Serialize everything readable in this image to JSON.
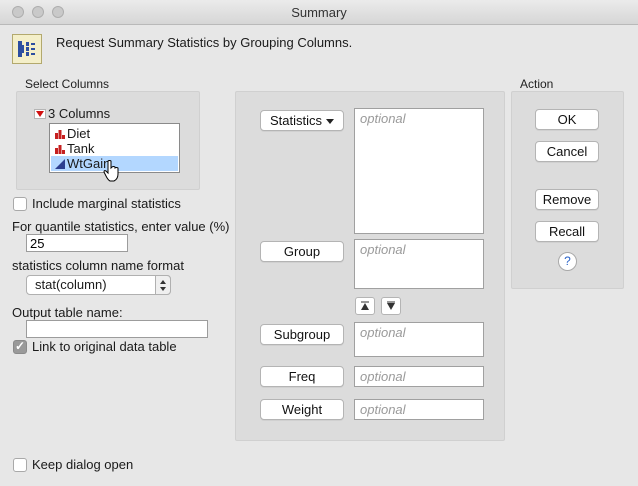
{
  "window": {
    "title": "Summary"
  },
  "header": {
    "text": "Request Summary Statistics by Grouping Columns.",
    "icon": "summary-icon"
  },
  "select_columns": {
    "label": "Select Columns",
    "count_label": "3 Columns",
    "items": [
      {
        "name": "Diet",
        "type": "nominal"
      },
      {
        "name": "Tank",
        "type": "nominal"
      },
      {
        "name": "WtGain",
        "type": "continuous",
        "selected": true
      }
    ]
  },
  "options": {
    "marginal_label": "Include marginal statistics",
    "quantile_label": "For quantile statistics, enter value (%)",
    "quantile_value": "25",
    "name_format_label": "statistics column name format",
    "name_format_value": "stat(column)",
    "output_name_label": "Output table name:",
    "output_name_value": "",
    "link_label": "Link to original data table",
    "link_checked": true,
    "keep_open_label": "Keep dialog open"
  },
  "roles": {
    "statistics_label": "Statistics",
    "group_label": "Group",
    "subgroup_label": "Subgroup",
    "freq_label": "Freq",
    "weight_label": "Weight",
    "placeholder": "optional"
  },
  "action": {
    "label": "Action",
    "ok": "OK",
    "cancel": "Cancel",
    "remove": "Remove",
    "recall": "Recall",
    "help": "?"
  }
}
